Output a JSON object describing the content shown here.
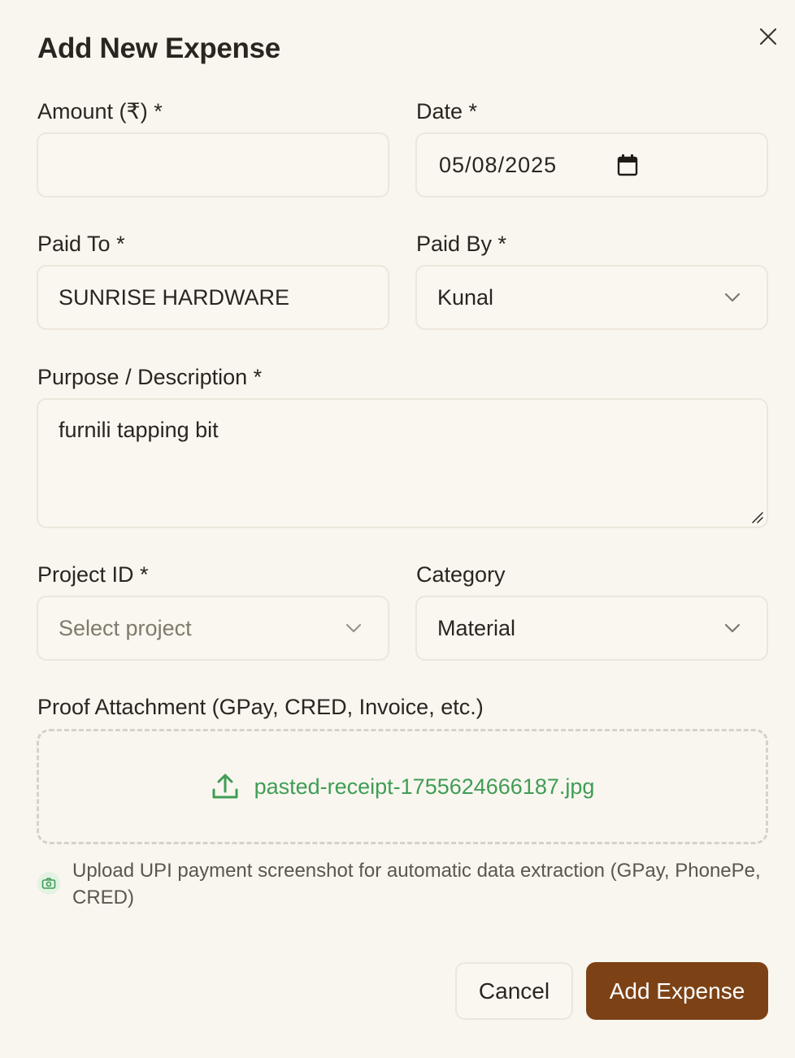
{
  "dialog": {
    "title": "Add New Expense",
    "close_icon": "close-icon"
  },
  "fields": {
    "amount": {
      "label": "Amount (₹) *",
      "value": ""
    },
    "date": {
      "label": "Date *",
      "value": "05/08/2025",
      "icon": "calendar-icon"
    },
    "paid_to": {
      "label": "Paid To *",
      "value": "SUNRISE HARDWARE"
    },
    "paid_by": {
      "label": "Paid By *",
      "value": "Kunal",
      "icon": "chevron-down-icon"
    },
    "purpose": {
      "label": "Purpose / Description *",
      "value": "furnili tapping bit"
    },
    "project_id": {
      "label": "Project ID *",
      "placeholder": "Select project",
      "value": "",
      "icon": "chevron-down-icon"
    },
    "category": {
      "label": "Category",
      "value": "Material",
      "icon": "chevron-down-icon"
    }
  },
  "attachment": {
    "label": "Proof Attachment (GPay, CRED, Invoice, etc.)",
    "file_name": "pasted-receipt-1755624666187.jpg",
    "icon": "upload-icon",
    "hint_icon": "camera-icon",
    "hint": "Upload UPI payment screenshot for automatic data extraction (GPay, PhonePe, CRED)"
  },
  "actions": {
    "cancel_label": "Cancel",
    "submit_label": "Add Expense"
  },
  "colors": {
    "background": "#f9f6ef",
    "primary_button": "#7c4216",
    "file_name_green": "#3f9d55",
    "border": "#ece6db"
  }
}
